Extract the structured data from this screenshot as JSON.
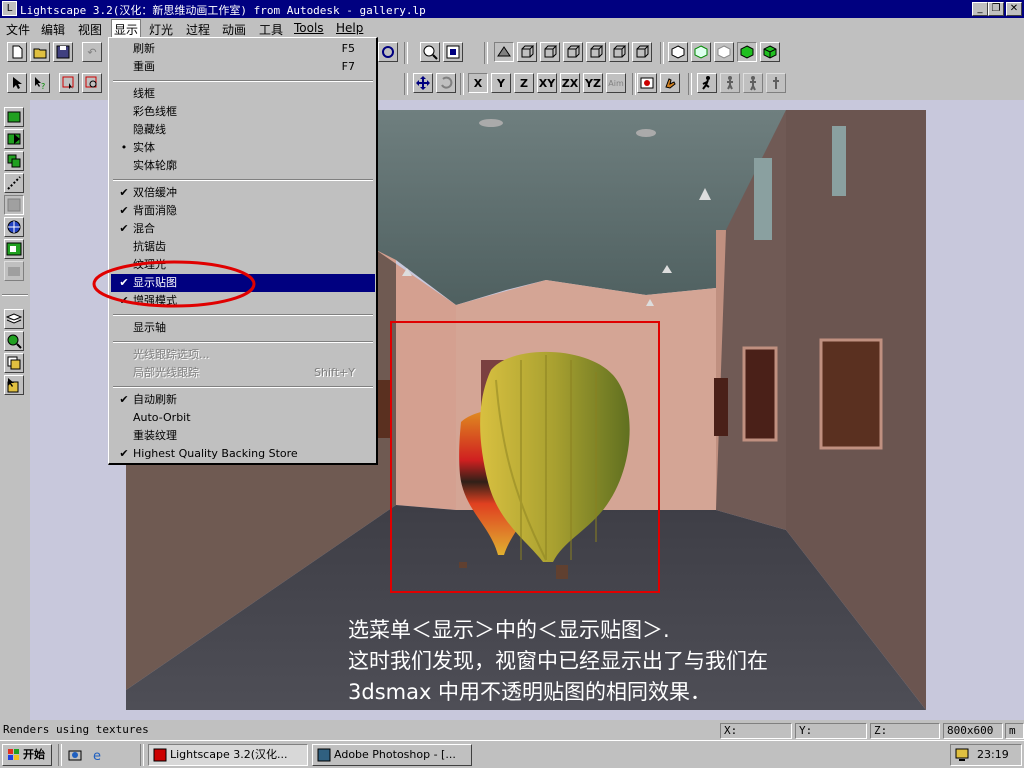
{
  "window": {
    "title": "Lightscape 3.2(汉化：新思维动画工作室) from Autodesk - gallery.lp",
    "buttons": [
      "_",
      "❐",
      "✕"
    ]
  },
  "menubar": [
    "文件",
    "编辑",
    "视图",
    "显示",
    "灯光",
    "过程",
    "动画",
    "工具",
    "Tools",
    "Help"
  ],
  "display_menu": {
    "items": [
      {
        "label": "刷新",
        "shortcut": "F5",
        "check": ""
      },
      {
        "label": "重画",
        "shortcut": "F7",
        "check": ""
      },
      {
        "label": "线框",
        "shortcut": "",
        "check": ""
      },
      {
        "label": "彩色线框",
        "shortcut": "",
        "check": ""
      },
      {
        "label": "隐藏线",
        "shortcut": "",
        "check": ""
      },
      {
        "label": "实体",
        "shortcut": "",
        "check": "•"
      },
      {
        "label": "实体轮廓",
        "shortcut": "",
        "check": ""
      },
      {
        "label": "双倍缓冲",
        "shortcut": "",
        "check": "✔"
      },
      {
        "label": "背面消隐",
        "shortcut": "",
        "check": "✔"
      },
      {
        "label": "混合",
        "shortcut": "",
        "check": "✔"
      },
      {
        "label": "抗锯齿",
        "shortcut": "",
        "check": ""
      },
      {
        "label": "纹理光",
        "shortcut": "",
        "check": ""
      },
      {
        "label": "显示贴图",
        "shortcut": "",
        "check": "✔"
      },
      {
        "label": "增强模式",
        "shortcut": "",
        "check": "✔"
      },
      {
        "label": "显示轴",
        "shortcut": "",
        "check": ""
      },
      {
        "label": "光线跟踪选项...",
        "shortcut": "",
        "check": ""
      },
      {
        "label": "局部光线跟踪",
        "shortcut": "Shift+Y",
        "check": ""
      },
      {
        "label": "自动刷新",
        "shortcut": "",
        "check": "✔"
      },
      {
        "label": "Auto-Orbit",
        "shortcut": "",
        "check": ""
      },
      {
        "label": "重装纹理",
        "shortcut": "",
        "check": ""
      },
      {
        "label": "Highest Quality Backing Store",
        "shortcut": "",
        "check": "✔"
      }
    ]
  },
  "axis_buttons": [
    "X",
    "Y",
    "Z",
    "XY",
    "ZX",
    "YZ",
    "Aim"
  ],
  "caption": {
    "line1": "选菜单＜显示＞中的＜显示贴图＞.",
    "line2": "这时我们发现，视窗中已经显示出了与我们在",
    "line3": "3dsmax 中用不透明贴图的相同效果．"
  },
  "statusbar": {
    "message": "Renders using textures",
    "x_label": "X:",
    "y_label": "Y:",
    "z_label": "Z:",
    "resolution": "800x600",
    "unit": "m"
  },
  "taskbar": {
    "start": "开始",
    "tasks": [
      "Lightscape 3.2(汉化...",
      "Adobe Photoshop - [..."
    ],
    "time": "23:19"
  },
  "colors": {
    "titlebar": "#000080",
    "highlight": "#000080",
    "annotation": "#e00000",
    "caption_text": "#ffffff"
  }
}
